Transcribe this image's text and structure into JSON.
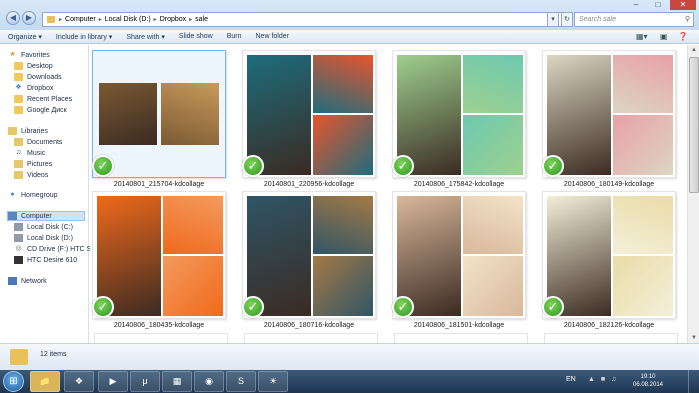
{
  "window": {
    "breadcrumb": [
      "Computer",
      "Local Disk (D:)",
      "Dropbox",
      "sale"
    ],
    "search_placeholder": "Search sale",
    "controls": {
      "minimize": "–",
      "maximize": "□",
      "close": "✕"
    }
  },
  "toolbar": {
    "items": [
      "Organize ▾",
      "Include in library ▾",
      "Share with ▾",
      "Slide show",
      "Burn",
      "New folder"
    ]
  },
  "sidebar": {
    "favorites": {
      "title": "Favorites",
      "items": [
        "Desktop",
        "Downloads",
        "Dropbox",
        "Recent Places",
        "Google Диск"
      ]
    },
    "libraries": {
      "title": "Libraries",
      "items": [
        "Documents",
        "Music",
        "Pictures",
        "Videos"
      ]
    },
    "homegroup": "Homegroup",
    "computer": {
      "title": "Computer",
      "items": [
        "Local Disk (C:)",
        "Local Disk (D:)",
        "CD Drive (F:) HTC Sy",
        "HTC Desire 610"
      ]
    },
    "network": "Network"
  },
  "files": [
    {
      "name": "20140801_215704-kdcollage",
      "colors": [
        "#7a5a33",
        "#c99a5a"
      ],
      "selected": true
    },
    {
      "name": "20140801_220956-kdcollage",
      "colors": [
        "#1d6d7c",
        "#e8542d"
      ],
      "selected": false
    },
    {
      "name": "20140806_175842-kdcollage",
      "colors": [
        "#9ed08f",
        "#6dc9b0"
      ],
      "selected": false
    },
    {
      "name": "20140806_180149-kdcollage",
      "colors": [
        "#dcd6c2",
        "#e8a0a8"
      ],
      "selected": false
    },
    {
      "name": "20140806_180435-kdcollage",
      "colors": [
        "#f06a1c",
        "#f39a5e"
      ],
      "selected": false
    },
    {
      "name": "20140806_180716-kdcollage",
      "colors": [
        "#2f5566",
        "#a57a45"
      ],
      "selected": false
    },
    {
      "name": "20140806_181501-kdcollage",
      "colors": [
        "#d8b89b",
        "#f3e3c8"
      ],
      "selected": false
    },
    {
      "name": "20140806_182126-kdcollage",
      "colors": [
        "#f4efd9",
        "#e9dca8"
      ],
      "selected": false
    }
  ],
  "status": {
    "item_count": "12 items"
  },
  "taskbar": {
    "start_icon": "windows-orb",
    "apps": [
      "explorer",
      "dropbox",
      "media",
      "utorrent",
      "image-viewer",
      "chrome",
      "skype",
      "firefox"
    ],
    "language": "EN",
    "time": "19:10",
    "date": "06.08.2014"
  }
}
